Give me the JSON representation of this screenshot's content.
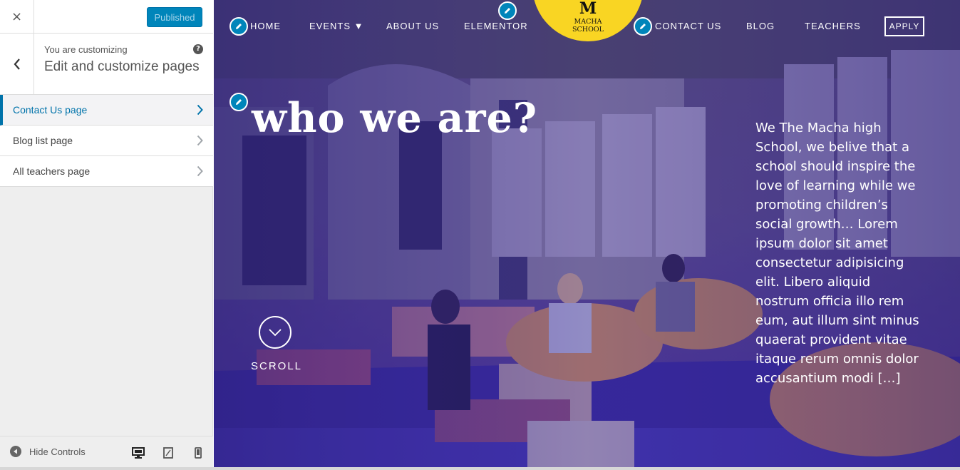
{
  "sidebar": {
    "close_label": "×",
    "publish_label": "Published",
    "customizing_label": "You are customizing",
    "section_title": "Edit and customize pages",
    "help_label": "?",
    "items": [
      {
        "label": "Contact Us page"
      },
      {
        "label": "Blog list page"
      },
      {
        "label": "All teachers page"
      }
    ],
    "hide_controls_label": "Hide Controls"
  },
  "nav": {
    "home": "HOME",
    "events": "EVENTS ▼",
    "about": "ABOUT US",
    "elementor": "ELEMENTOR",
    "contact": "CONTACT US",
    "blog": "BLOG",
    "teachers": "TEACHERS",
    "apply": "APPLY"
  },
  "logo": {
    "mark": "M",
    "line1": "MACHA",
    "line2": "SCHOOL"
  },
  "hero": {
    "title": "who we are?",
    "text": "We The Macha high School, we belive that a school should inspire the love of learning while we promoting children’s social growth… Lorem ipsum dolor sit amet consectetur adipisicing elit. Libero aliquid nostrum officia illo rem eum, aut illum sint minus quaerat provident vitae itaque rerum omnis dolor accusantium modi […]",
    "scroll_label": "SCROLL"
  },
  "colors": {
    "accent": "#0085ba",
    "logo_yellow": "#f9d523",
    "overlay_purple": "#3b2a9a"
  }
}
